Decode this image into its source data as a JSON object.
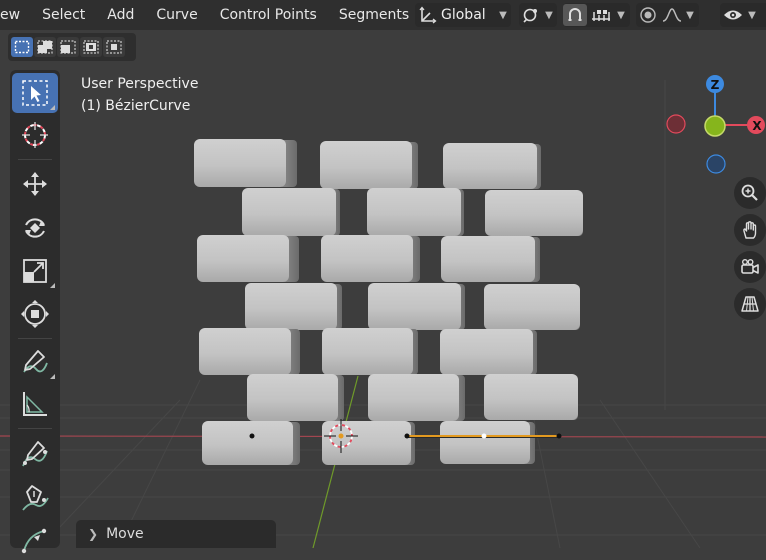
{
  "menu": [
    "ew",
    "Select",
    "Add",
    "Curve",
    "Control Points",
    "Segments"
  ],
  "transform_orientation": "Global",
  "viewport": {
    "view_name": "User Perspective",
    "object_name": "(1) BézierCurve"
  },
  "gizmo": {
    "z_label": "Z",
    "x_label": "X"
  },
  "operator_panel": {
    "label": "Move"
  },
  "colors": {
    "accent": "#4772b3",
    "axis_x": "#e34a5c",
    "axis_y": "#86b51c",
    "axis_z": "#3d8ae0",
    "curve_segment": "#e39a20"
  },
  "icons": [
    "transform-pivot-icon",
    "snap-icon",
    "proportional-editing-icon",
    "select-box-tool-icon",
    "cursor-tool-icon",
    "move-tool-icon",
    "rotate-tool-icon",
    "scale-tool-icon",
    "transform-tool-icon",
    "annotate-tool-icon",
    "measure-tool-icon",
    "draw-curve-tool-icon",
    "pen-tool-icon",
    "curve-radius-tool-icon",
    "zoom-icon",
    "hand-icon",
    "camera-icon",
    "grid-icon",
    "eye-icon"
  ]
}
